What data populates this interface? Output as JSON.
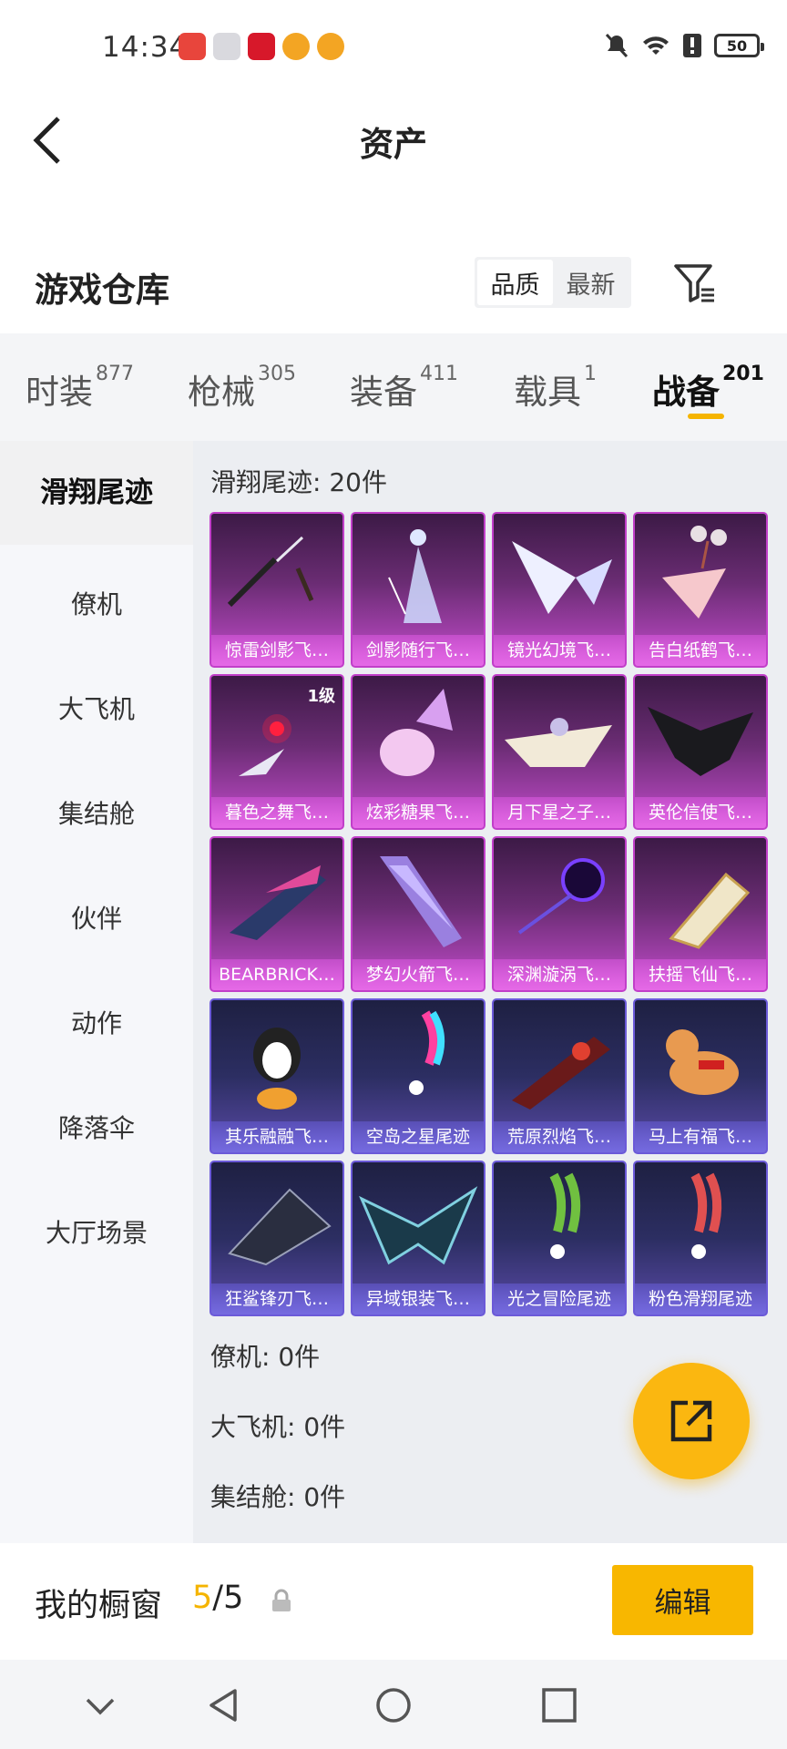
{
  "status_bar": {
    "time": "14:34",
    "battery": "50",
    "app_icon_colors": [
      "#e8453c",
      "#d9d9de",
      "#d7182a",
      "#f3a523",
      "#f3a523"
    ]
  },
  "header": {
    "title": "资产"
  },
  "warehouse": {
    "title": "游戏仓库",
    "sort_options": [
      "品质",
      "最新"
    ],
    "active_sort": "品质"
  },
  "tabs": [
    {
      "label": "时装",
      "count": "877"
    },
    {
      "label": "枪械",
      "count": "305"
    },
    {
      "label": "装备",
      "count": "411"
    },
    {
      "label": "载具",
      "count": "1"
    },
    {
      "label": "战备",
      "count": "201"
    }
  ],
  "active_tab": "战备",
  "sidebar": {
    "items": [
      "滑翔尾迹",
      "僚机",
      "大飞机",
      "集结舱",
      "伙伴",
      "动作",
      "降落伞",
      "大厅场景"
    ],
    "active": "滑翔尾迹"
  },
  "content": {
    "section_title": "滑翔尾迹: 20件",
    "items": [
      {
        "name": "惊雷剑影飞…",
        "tier": "purple",
        "icon": "twin-blades-icon"
      },
      {
        "name": "剑影随行飞…",
        "tier": "purple",
        "icon": "fairy-figure-icon"
      },
      {
        "name": "镜光幻境飞…",
        "tier": "purple",
        "icon": "crystal-wings-icon"
      },
      {
        "name": "告白纸鹤飞…",
        "tier": "purple",
        "icon": "paper-crane-icon"
      },
      {
        "name": "暮色之舞飞…",
        "tier": "purple",
        "icon": "red-orb-wings-icon",
        "level": "1级"
      },
      {
        "name": "炫彩糖果飞…",
        "tier": "purple",
        "icon": "candy-glider-icon"
      },
      {
        "name": "月下星之子…",
        "tier": "purple",
        "icon": "star-glider-icon"
      },
      {
        "name": "英伦信使飞…",
        "tier": "purple",
        "icon": "raven-icon"
      },
      {
        "name": "BEARBRICK…",
        "tier": "purple",
        "icon": "bearbrick-glider-icon"
      },
      {
        "name": "梦幻火箭飞…",
        "tier": "purple",
        "icon": "rocket-glider-icon"
      },
      {
        "name": "深渊漩涡飞…",
        "tier": "purple",
        "icon": "vortex-icon"
      },
      {
        "name": "扶摇飞仙飞…",
        "tier": "purple",
        "icon": "golden-glider-icon"
      },
      {
        "name": "其乐融融飞…",
        "tier": "blue",
        "icon": "penguin-icon"
      },
      {
        "name": "空岛之星尾迹",
        "tier": "blue",
        "icon": "rainbow-trail-icon"
      },
      {
        "name": "荒原烈焰飞…",
        "tier": "blue",
        "icon": "flame-glider-icon"
      },
      {
        "name": "马上有福飞…",
        "tier": "blue",
        "icon": "lucky-horse-icon"
      },
      {
        "name": "狂鲨锋刃飞…",
        "tier": "blue",
        "icon": "shark-glider-icon"
      },
      {
        "name": "异域银装飞…",
        "tier": "blue",
        "icon": "silver-glider-icon"
      },
      {
        "name": "光之冒险尾迹",
        "tier": "blue",
        "icon": "green-trail-icon"
      },
      {
        "name": "粉色滑翔尾迹",
        "tier": "blue",
        "icon": "pink-trail-icon"
      }
    ],
    "other_sections": [
      "僚机: 0件",
      "大飞机: 0件",
      "集结舱: 0件"
    ]
  },
  "showcase": {
    "label": "我的橱窗",
    "current": "5",
    "separator": "/",
    "total": "5",
    "edit_label": "编辑"
  },
  "colors": {
    "accent": "#f8b700",
    "purple_tier": "#c13fc9",
    "blue_tier": "#6b5ad8"
  }
}
